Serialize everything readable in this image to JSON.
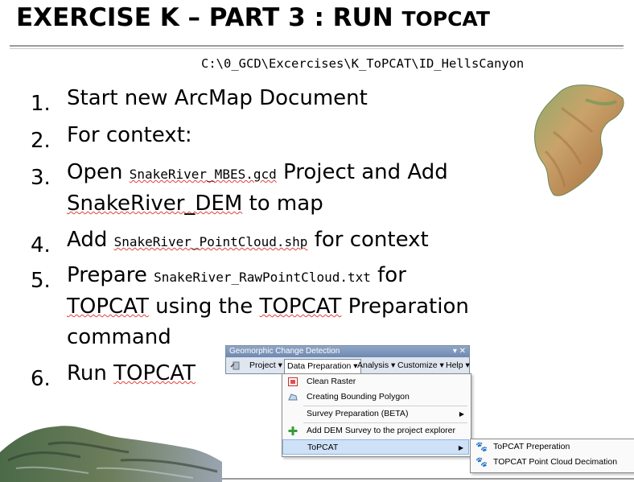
{
  "slide": {
    "title_main": "EXERCISE K – PART 3 :   RUN ",
    "title_tail": "TOPCAT",
    "path": "C:\\0_GCD\\Excercises\\K_ToPCAT\\ID_HellsCanyon"
  },
  "steps": [
    {
      "num": "1.",
      "text": "Start new ArcMap Document"
    },
    {
      "num": "2.",
      "text": "For context:"
    },
    {
      "num": "3.",
      "a": "Open ",
      "file": "SnakeRiver_MBES.gcd",
      "b": " Project and Add",
      "line2_link": "SnakeRiver_DEM",
      "line2_rest": " to map"
    },
    {
      "num": "4.",
      "a": "Add ",
      "file": "SnakeRiver_PointCloud.shp",
      "b": " for context"
    },
    {
      "num": "5.",
      "a": "Prepare ",
      "file": "SnakeRiver_RawPointCloud.txt",
      "b": "  for",
      "line2_a": "TOPCAT",
      "line2_b": " using the ",
      "line2_c": "TOPCAT",
      "line2_d": " Preparation",
      "line3": "command"
    },
    {
      "num": "6.",
      "a": "Run ",
      "link": "TOPCAT"
    }
  ],
  "toolbar": {
    "title": "Geomorphic Change Detection",
    "controls": "▾ ✕",
    "items": [
      "Project ▾",
      "Data Preparation ▾",
      "Analysis ▾",
      "Customize ▾",
      "Help ▾"
    ]
  },
  "menu": {
    "items": [
      {
        "label": "Clean Raster",
        "icon": "clean-raster-icon"
      },
      {
        "label": "Creating Bounding Polygon",
        "icon": "polygon-icon"
      },
      {
        "label": "Survey Preparation (BETA)",
        "icon": "",
        "arrow": "▶"
      },
      {
        "label": "Add DEM Survey to the project explorer",
        "icon": "add-icon"
      },
      {
        "label": "ToPCAT",
        "icon": "",
        "arrow": "▶"
      }
    ]
  },
  "submenu": {
    "items": [
      {
        "label": "ToPCAT Preperation",
        "icon": "paw-icon"
      },
      {
        "label": "TOPCAT Point Cloud Decimation",
        "icon": "paw-icon"
      }
    ]
  },
  "colors": {
    "accent_highlight": "#cfe1f7",
    "squiggle": "#e04040",
    "toolbar_title": "#6f89b0"
  }
}
